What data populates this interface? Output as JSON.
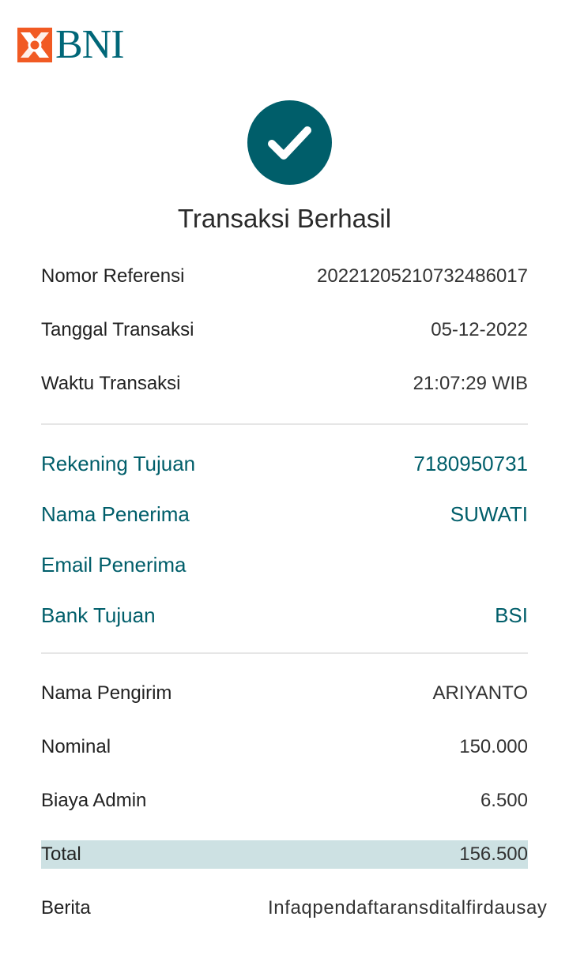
{
  "brand": {
    "name": "BNI",
    "logo_color": "#006778",
    "mark_color": "#f15a23"
  },
  "status": {
    "icon": "check-icon",
    "title": "Transaksi Berhasil",
    "circle_color": "#005e6a"
  },
  "transaction": {
    "reference_label": "Nomor Referensi",
    "reference_value": "20221205210732486017",
    "date_label": "Tanggal Transaksi",
    "date_value": "05-12-2022",
    "time_label": "Waktu Transaksi",
    "time_value": "21:07:29 WIB"
  },
  "recipient": {
    "account_label": "Rekening Tujuan",
    "account_value": "7180950731",
    "name_label": "Nama Penerima",
    "name_value": "SUWATI",
    "email_label": "Email Penerima",
    "email_value": "",
    "bank_label": "Bank Tujuan",
    "bank_value": "BSI"
  },
  "payment": {
    "sender_label": "Nama Pengirim",
    "sender_value": "ARIYANTO",
    "amount_label": "Nominal",
    "amount_value": "150.000",
    "fee_label": "Biaya Admin",
    "fee_value": "6.500",
    "total_label": "Total",
    "total_value": "156.500",
    "message_label": "Berita",
    "message_value": "Infaqpendaftaransditalfirdausay"
  },
  "colors": {
    "accent": "#005e6a",
    "total_highlight": "#cde1e3",
    "divider": "#e6e6e6"
  }
}
